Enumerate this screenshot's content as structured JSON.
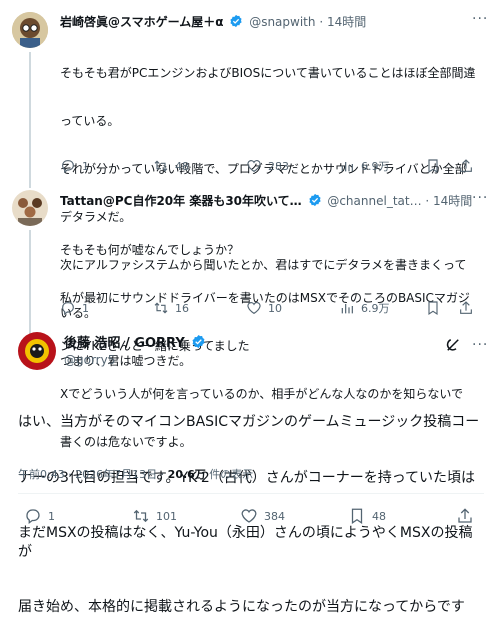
{
  "colors": {
    "accent": "#1d9bf0",
    "text": "#0f1419",
    "muted": "#536471",
    "divider": "#eff3f4"
  },
  "tweet1": {
    "name": "岩崎啓眞@スマホゲーム屋＋α",
    "handle": "@snapwith",
    "time": "· 14時間",
    "lines": [
      "そもそも君がPCエンジンおよびBIOSについて書いていることはほぼ全部間違",
      "っている。",
      "それが分かっていない段階で、プログラマだとかサウンドドライバとか全部",
      "デタラメだ。",
      "次にアルファシステムから聞いたとか、君はすでにデタラメを書きまくって",
      "いる。",
      "つまり、君は嘘つきだ。"
    ],
    "actions": {
      "reply": "1",
      "retweet": "48",
      "like": "283",
      "views": "6.9万"
    }
  },
  "tweet2": {
    "name": "Tattan@PC自作20年 楽器も30年吹いて…",
    "handle": "@channel_tat…",
    "time": "· 14時間",
    "lines": [
      "そもそも何が嘘なんでしょうか？",
      "私が最初にサウンドドライバーを書いたのはMSXでそのころのBASICマガジ",
      "ンにYK2さんと一緒に乗ってました",
      "Xでどういう人が何を言っているのか、相手がどんな人なのかを知らないで",
      "書くのは危ないですよ。"
    ],
    "actions": {
      "reply": "1",
      "retweet": "16",
      "like": "10",
      "views": "6.9万"
    }
  },
  "main": {
    "name": "後藤 浩昭 / GORRY",
    "handle": "@gorry5",
    "lines": [
      "はい、当方がそのマイコンBASICマガジンのゲームミュージック投稿コー",
      "ナーの3代目の担当です。YK-2（古代）さんがコーナーを持っていた頃は",
      "まだMSXの投稿はなく、Yu-You（永田）さんの頃にようやくMSXの投稿が",
      "届き始め、本格的に掲載されるようになったのが当方になってからです"
    ],
    "timestamp": "午前0:43 · 2026年7月13日 · ",
    "views_count": "20.6万",
    "views_label": " 件の表示",
    "actions": {
      "reply": "1",
      "retweet": "101",
      "like": "384",
      "bookmark": "48"
    }
  }
}
